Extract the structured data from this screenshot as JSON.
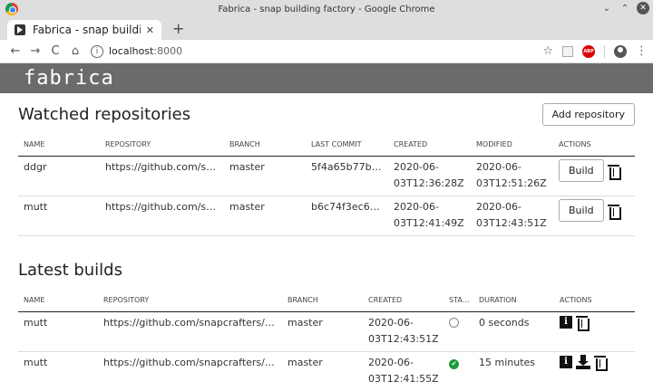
{
  "window": {
    "title": "Fabrica - snap building factory - Google Chrome",
    "min": "⌄",
    "max": "⌃",
    "close": "✕"
  },
  "tab": {
    "title": "Fabrica - snap building",
    "close": "✕",
    "new": "+"
  },
  "toolbar": {
    "back": "←",
    "forward": "→",
    "reload": "C",
    "home": "⌂",
    "url_host": "localhost",
    "url_port": ":8000",
    "info": "i",
    "star": "☆",
    "abp": "ABP",
    "menu": "⋮"
  },
  "app": {
    "logo": "fabrica"
  },
  "watched": {
    "title": "Watched repositories",
    "add_button": "Add repository",
    "columns": [
      "NAME",
      "REPOSITORY",
      "BRANCH",
      "LAST COMMIT",
      "CREATED",
      "MODIFIED",
      "ACTIONS"
    ],
    "build_label": "Build",
    "rows": [
      {
        "name": "ddgr",
        "repository": "https://github.com/snapcrafters/ddgr",
        "branch": "master",
        "last_commit": "5f4a65b77b6…",
        "created": "2020-06-03T12:36:28Z",
        "modified": "2020-06-03T12:51:26Z"
      },
      {
        "name": "mutt",
        "repository": "https://github.com/snapcrafters/mutt",
        "branch": "master",
        "last_commit": "b6c74f3ec6e…",
        "created": "2020-06-03T12:41:49Z",
        "modified": "2020-06-03T12:43:51Z"
      }
    ]
  },
  "builds": {
    "title": "Latest builds",
    "columns": [
      "NAME",
      "REPOSITORY",
      "BRANCH",
      "CREATED",
      "STA…",
      "DURATION",
      "ACTIONS"
    ],
    "rows": [
      {
        "name": "mutt",
        "repository": "https://github.com/snapcrafters/mutt",
        "branch": "master",
        "created": "2020-06-03T12:43:51Z",
        "status": "pending",
        "duration": "0 seconds"
      },
      {
        "name": "mutt",
        "repository": "https://github.com/snapcrafters/mutt",
        "branch": "master",
        "created": "2020-06-03T12:41:55Z",
        "status": "complete",
        "duration": "15 minutes"
      }
    ]
  }
}
